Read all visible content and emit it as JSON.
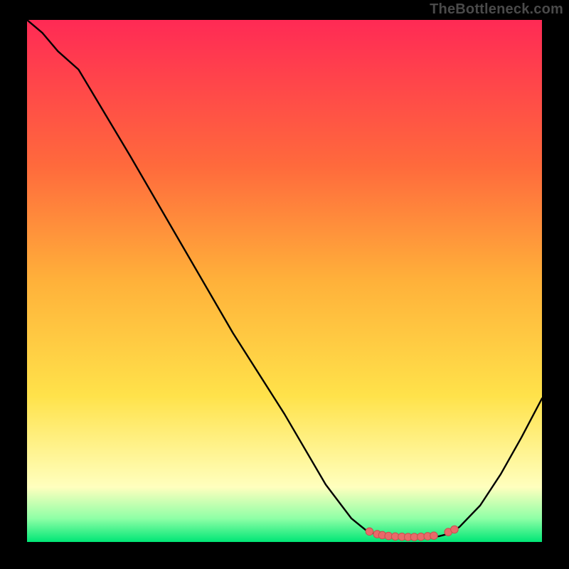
{
  "watermark": "TheBottleneck.com",
  "colors": {
    "page_bg": "#000000",
    "grad_top": "#ff2a55",
    "grad_mid1": "#ff6a3c",
    "grad_mid2": "#ffb13a",
    "grad_mid3": "#ffe24a",
    "grad_pale": "#ffffbe",
    "grad_green1": "#8effa6",
    "grad_green2": "#00e676",
    "curve_stroke": "#000000",
    "marker_fill": "#e86a6a",
    "marker_stroke": "#c94f4f"
  },
  "chart_data": {
    "type": "line",
    "title": "",
    "xlabel": "",
    "ylabel": "",
    "xlim": [
      0,
      100
    ],
    "ylim": [
      0,
      100
    ],
    "curve": [
      {
        "x": 0,
        "y": 100
      },
      {
        "x": 3,
        "y": 97.5
      },
      {
        "x": 6,
        "y": 94
      },
      {
        "x": 10,
        "y": 90.5
      },
      {
        "x": 20,
        "y": 74
      },
      {
        "x": 30,
        "y": 57
      },
      {
        "x": 40,
        "y": 40
      },
      {
        "x": 50,
        "y": 24.5
      },
      {
        "x": 58,
        "y": 11
      },
      {
        "x": 63,
        "y": 4.5
      },
      {
        "x": 66,
        "y": 2.1
      },
      {
        "x": 68,
        "y": 1.4
      },
      {
        "x": 70,
        "y": 1.0
      },
      {
        "x": 72,
        "y": 0.85
      },
      {
        "x": 75,
        "y": 0.8
      },
      {
        "x": 78,
        "y": 0.9
      },
      {
        "x": 80,
        "y": 1.1
      },
      {
        "x": 82,
        "y": 1.6
      },
      {
        "x": 84,
        "y": 2.9
      },
      {
        "x": 88,
        "y": 7
      },
      {
        "x": 92,
        "y": 13
      },
      {
        "x": 96,
        "y": 20
      },
      {
        "x": 100,
        "y": 27.5
      }
    ],
    "markers": [
      {
        "x": 66.5,
        "y": 2.0
      },
      {
        "x": 68.0,
        "y": 1.5
      },
      {
        "x": 69.0,
        "y": 1.3
      },
      {
        "x": 70.2,
        "y": 1.15
      },
      {
        "x": 71.5,
        "y": 1.05
      },
      {
        "x": 72.8,
        "y": 1.0
      },
      {
        "x": 74.0,
        "y": 0.95
      },
      {
        "x": 75.2,
        "y": 0.95
      },
      {
        "x": 76.5,
        "y": 1.0
      },
      {
        "x": 77.8,
        "y": 1.1
      },
      {
        "x": 79.0,
        "y": 1.2
      },
      {
        "x": 81.8,
        "y": 1.9
      },
      {
        "x": 83.0,
        "y": 2.4
      }
    ],
    "gradient_stops": [
      {
        "offset": 0,
        "key": "grad_top"
      },
      {
        "offset": 0.28,
        "key": "grad_mid1"
      },
      {
        "offset": 0.5,
        "key": "grad_mid2"
      },
      {
        "offset": 0.72,
        "key": "grad_mid3"
      },
      {
        "offset": 0.895,
        "key": "grad_pale"
      },
      {
        "offset": 0.955,
        "key": "grad_green1"
      },
      {
        "offset": 1.0,
        "key": "grad_green2"
      }
    ]
  }
}
